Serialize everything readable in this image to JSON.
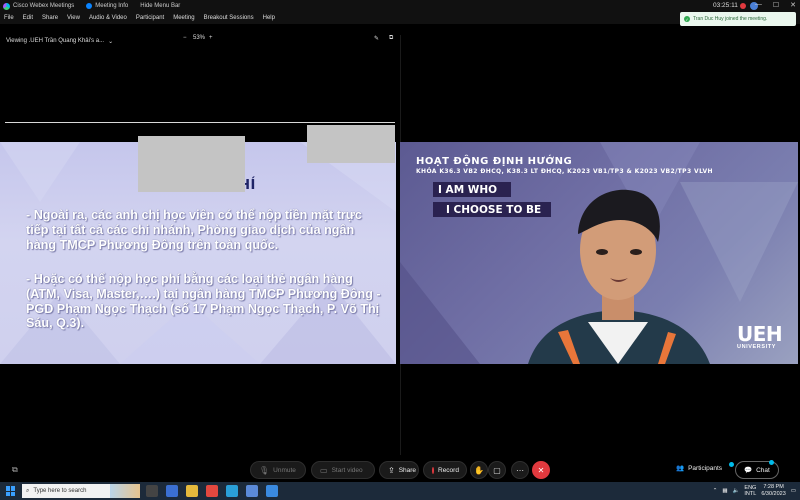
{
  "titlebar": {
    "app_name": "Cisco Webex Meetings",
    "meeting_info": "Meeting Info",
    "hide_menu": "Hide Menu Bar",
    "clock": "03:25:11",
    "minimize": "—",
    "maximize": "☐",
    "close": "✕"
  },
  "menu": [
    "File",
    "Edit",
    "Share",
    "View",
    "Audio & Video",
    "Participant",
    "Meeting",
    "Breakout Sessions",
    "Help"
  ],
  "toast": {
    "message": "Tran Duc Huy joined the meeting."
  },
  "viewbar": {
    "viewing": "Viewing .UEH Trần Quang Khải's a...",
    "zoom_minus": "−",
    "zoom_level": "53%",
    "zoom_plus": "+"
  },
  "slide": {
    "title": "HƯỚN           HỌC PHÍ",
    "p1": "- Ngoài ra, các anh chị học viên có thể nộp tiền mặt trực tiếp tại tất cả các chi nhánh, Phòng giao dịch của ngân hàng TMCP Phương Đông trên toàn quốc.",
    "p2": "- Hoặc có thể nộp học phí bằng các loại thẻ ngân hàng (ATM, Visa, Master,….) tại ngân hàng TMCP Phương Đông - PGD Phạm Ngọc Thạch (số 17 Phạm Ngọc Thạch, P. Võ Thị Sáu, Q.3)."
  },
  "video": {
    "heading": "HOẠT ĐỘNG ĐỊNH HƯỚNG",
    "sub": "KHÓA K36.3 VB2 ĐHCQ, K38.3 LT ĐHCQ, K2023 VB1/TP3 & K2023 VB2/TP3 VLVH",
    "banner1": "I AM WHO",
    "banner2": "I CHOOSE TO BE",
    "brand": "UEH",
    "brand_sub": "UNIVERSITY"
  },
  "controls": {
    "unmute": "Unmute",
    "start_video": "Start video",
    "share": "Share",
    "record": "Record",
    "participants": "Participants",
    "chat": "Chat"
  },
  "taskbar": {
    "search_placeholder": "Type here to search",
    "lang_top": "ENG",
    "lang_bottom": "INTL",
    "time": "7:28 PM",
    "date": "6/30/2023"
  }
}
